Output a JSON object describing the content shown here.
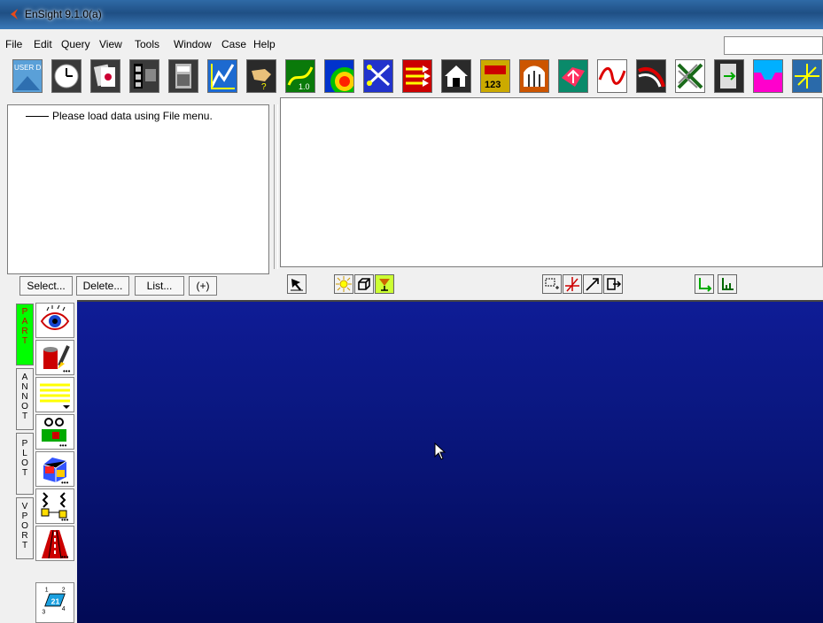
{
  "window": {
    "title": "EnSight 9.1.0(a)"
  },
  "menu": {
    "items": [
      "File",
      "Edit",
      "Query",
      "View",
      "Tools",
      "Window",
      "Case",
      "Help"
    ]
  },
  "toolbar": {
    "icons": [
      "user-defined-icon",
      "clock-icon",
      "cards-icon",
      "film-icon",
      "calculator-icon",
      "graph-icon",
      "hand-query-icon",
      "line-plot-icon",
      "contour-icon",
      "scissors-icon",
      "arrows-icon",
      "house-icon",
      "numbers-icon",
      "elevated-surface-icon",
      "isosurface-icon",
      "wave-icon",
      "vortex-icon",
      "cross-icon",
      "door-icon",
      "profile-icon",
      "axes-icon"
    ],
    "user_def_label": "USER DEF",
    "line_plot_label": "1.0",
    "numbers_label": "123"
  },
  "part_list": {
    "message": "Please load data using File menu."
  },
  "part_buttons": {
    "select": "Select...",
    "delete": "Delete...",
    "list": "List...",
    "plus": "(+)"
  },
  "mode_tabs": [
    {
      "name": "PART",
      "letters": [
        "P",
        "A",
        "R",
        "T"
      ],
      "active": true
    },
    {
      "name": "ANNOT",
      "letters": [
        "A",
        "N",
        "N",
        "O",
        "T"
      ],
      "active": false
    },
    {
      "name": "PLOT",
      "letters": [
        "P",
        "L",
        "O",
        "T"
      ],
      "active": false
    },
    {
      "name": "VPORT",
      "letters": [
        "V",
        "P",
        "O",
        "R",
        "T"
      ],
      "active": false
    }
  ],
  "side_tools": {
    "viewport_number": "21",
    "corner_numbers": [
      "1",
      "2",
      "3",
      "4"
    ]
  },
  "colors": {
    "viewport_top": "#0f1c96",
    "viewport_bottom": "#020a55",
    "active_tab": "#00ff00",
    "title_bar": "#1f4f84"
  }
}
